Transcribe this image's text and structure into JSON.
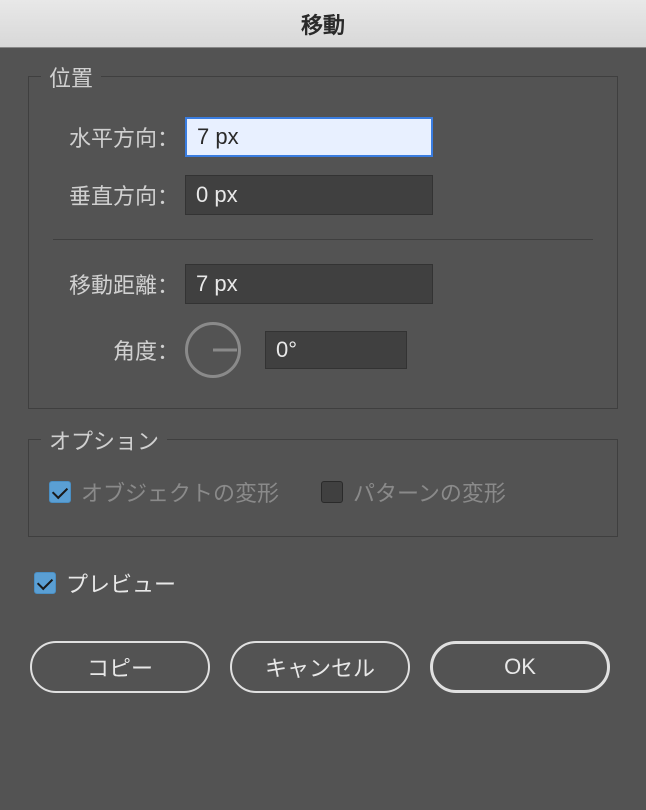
{
  "title": "移動",
  "position": {
    "legend": "位置",
    "horizontal_label": "水平方向：",
    "horizontal_value": "7 px",
    "vertical_label": "垂直方向：",
    "vertical_value": "0 px",
    "distance_label": "移動距離：",
    "distance_value": "7 px",
    "angle_label": "角度：",
    "angle_value": "0°"
  },
  "options": {
    "legend": "オプション",
    "transform_objects_label": "オブジェクトの変形",
    "transform_objects_checked": true,
    "transform_patterns_label": "パターンの変形",
    "transform_patterns_checked": false
  },
  "preview": {
    "label": "プレビュー",
    "checked": true
  },
  "buttons": {
    "copy": "コピー",
    "cancel": "キャンセル",
    "ok": "OK"
  }
}
